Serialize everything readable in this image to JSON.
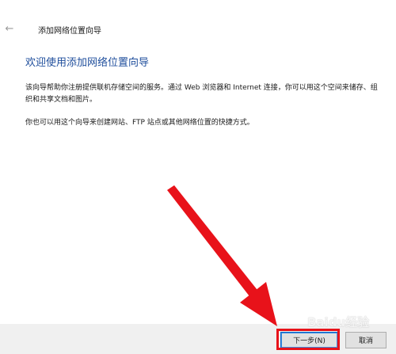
{
  "window": {
    "title": "添加网络位置向导",
    "back_icon": "back-arrow-icon"
  },
  "content": {
    "heading": "欢迎使用添加网络位置向导",
    "paragraph1": "该向导帮助你注册提供联机存储空间的服务。通过 Web 浏览器和 Internet 连接，你可以用这个空间来储存、组织和共享文档和图片。",
    "paragraph2": "你也可以用这个向导来创建网站、FTP 站点或其他网络位置的快捷方式。"
  },
  "footer": {
    "next_label": "下一步(N)",
    "cancel_label": "取消"
  },
  "annotation": {
    "arrow_color": "#e8121a",
    "highlight_color": "#e8121a",
    "watermark_text": "Baidu经验"
  },
  "colors": {
    "heading": "#1f4e9c",
    "footer_bg": "#f0f0f0",
    "primary_border": "#0a64c8"
  }
}
